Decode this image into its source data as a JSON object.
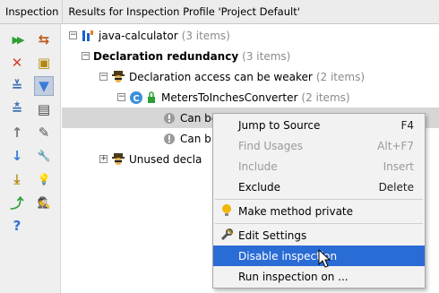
{
  "header": {
    "panel_title": "Inspection",
    "results_title": "Results for Inspection Profile 'Project Default'"
  },
  "toolbar": {
    "buttons": [
      {
        "name": "rerun-icon",
        "glyph": "▶▶",
        "color": "#2e9f34"
      },
      {
        "name": "export-icon",
        "glyph": "⇆",
        "color": "#c05a1c"
      },
      {
        "name": "close-icon",
        "glyph": "✕",
        "color": "#d0402b"
      },
      {
        "name": "autoscroll-icon",
        "glyph": "▣",
        "color": "#b08a10"
      },
      {
        "name": "expand-all-icon",
        "glyph": "≚",
        "color": "#3b6fb6"
      },
      {
        "name": "filter-icon",
        "glyph": "▼",
        "color": "#3a7bd5"
      },
      {
        "name": "collapse-all-icon",
        "glyph": "≛",
        "color": "#3b6fb6"
      },
      {
        "name": "group-by-directory-icon",
        "glyph": "▤",
        "color": "#444444"
      },
      {
        "name": "previous-icon",
        "glyph": "↑",
        "color": "#777777"
      },
      {
        "name": "edit-settings-icon",
        "glyph": "✎",
        "color": "#555555"
      },
      {
        "name": "next-icon",
        "glyph": "↓",
        "color": "#3a7bd5"
      },
      {
        "name": "settings-wrench-icon",
        "glyph": "🔧",
        "color": "#555555"
      },
      {
        "name": "import-icon",
        "glyph": "⤓",
        "color": "#b08a10"
      },
      {
        "name": "quickfix-bulb-icon",
        "glyph": "💡",
        "color": "#e6a600"
      },
      {
        "name": "export-results-icon",
        "glyph": "⤴",
        "color": "#2e9f34"
      },
      {
        "name": "inspector-icon",
        "glyph": "🕵",
        "color": "#1f3f7a"
      },
      {
        "name": "help-icon",
        "glyph": "?",
        "color": "#2f6fd0"
      }
    ]
  },
  "tree": {
    "project": {
      "label": "java-calculator",
      "count": "(3 items)"
    },
    "group": {
      "label": "Declaration redundancy",
      "count": "(3 items)"
    },
    "inspection": {
      "label": "Declaration access can be weaker",
      "count": "(2 items)"
    },
    "cls": {
      "label": "MetersToInchesConverter",
      "count": "(2 items)"
    },
    "problem1": {
      "label": "Can be private"
    },
    "problem2": {
      "label": "Can b"
    },
    "unused": {
      "label": "Unused decla"
    }
  },
  "menu": {
    "items": [
      {
        "label": "Jump to Source",
        "shortcut": "F4",
        "disabled": false
      },
      {
        "label": "Find Usages",
        "shortcut": "Alt+F7",
        "disabled": true
      },
      {
        "label": "Include",
        "shortcut": "Insert",
        "disabled": true
      },
      {
        "label": "Exclude",
        "shortcut": "Delete",
        "disabled": false
      },
      {
        "label": "Make method private",
        "shortcut": "",
        "disabled": false
      },
      {
        "label": "Edit Settings",
        "shortcut": "",
        "disabled": false
      },
      {
        "label": "Disable inspection",
        "shortcut": "",
        "disabled": false,
        "highlighted": true
      },
      {
        "label": "Run inspection on ...",
        "shortcut": "",
        "disabled": false
      }
    ]
  },
  "colors": {
    "highlight": "#2a6cd6",
    "selection_row": "#d6d6d6",
    "muted_text": "#8a8a8a"
  }
}
